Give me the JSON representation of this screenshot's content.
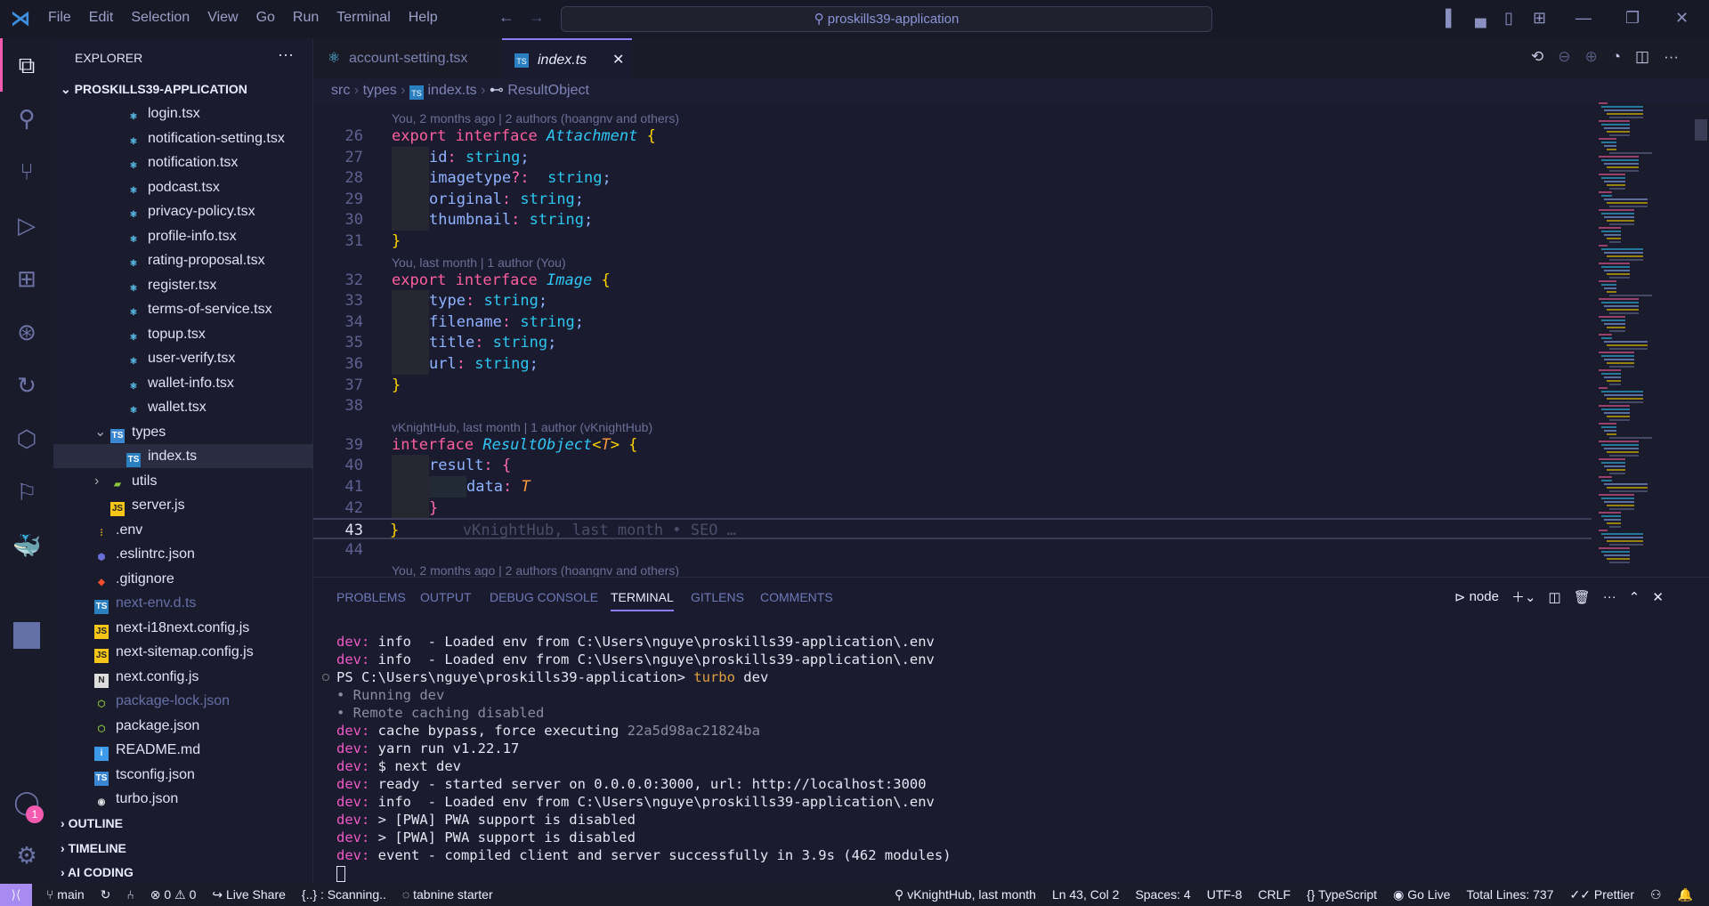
{
  "title_bar": {
    "menu": [
      "File",
      "Edit",
      "Selection",
      "View",
      "Go",
      "Run",
      "Terminal",
      "Help"
    ],
    "search": "proskills39-application"
  },
  "sidebar": {
    "header": "EXPLORER",
    "root": "PROSKILLS39-APPLICATION",
    "items": [
      {
        "label": "login.tsx",
        "icon": "react-icon",
        "indent": 2
      },
      {
        "label": "notification-setting.tsx",
        "icon": "react-icon",
        "indent": 2
      },
      {
        "label": "notification.tsx",
        "icon": "react-icon",
        "indent": 2
      },
      {
        "label": "podcast.tsx",
        "icon": "react-icon",
        "indent": 2
      },
      {
        "label": "privacy-policy.tsx",
        "icon": "react-icon",
        "indent": 2
      },
      {
        "label": "profile-info.tsx",
        "icon": "react-icon",
        "indent": 2
      },
      {
        "label": "rating-proposal.tsx",
        "icon": "react-icon",
        "indent": 2
      },
      {
        "label": "register.tsx",
        "icon": "react-icon",
        "indent": 2
      },
      {
        "label": "terms-of-service.tsx",
        "icon": "react-icon",
        "indent": 2
      },
      {
        "label": "topup.tsx",
        "icon": "react-icon",
        "indent": 2
      },
      {
        "label": "user-verify.tsx",
        "icon": "react-icon",
        "indent": 2
      },
      {
        "label": "wallet-info.tsx",
        "icon": "react-icon",
        "indent": 2
      },
      {
        "label": "wallet.tsx",
        "icon": "react-icon",
        "indent": 2
      },
      {
        "label": "types",
        "icon": "ts-folder-icon",
        "indent": 1,
        "chevron": "down"
      },
      {
        "label": "index.ts",
        "icon": "ts-file-icon",
        "indent": 2,
        "selected": true
      },
      {
        "label": "utils",
        "icon": "folder-icon",
        "indent": 1,
        "chevron": "right"
      },
      {
        "label": "server.js",
        "icon": "js-file-icon",
        "indent": 1
      },
      {
        "label": ".env",
        "icon": "env-icon",
        "indent": 0
      },
      {
        "label": ".eslintrc.json",
        "icon": "eslint-icon",
        "indent": 0
      },
      {
        "label": ".gitignore",
        "icon": "git-icon",
        "indent": 0
      },
      {
        "label": "next-env.d.ts",
        "icon": "ts-file-icon",
        "indent": 0,
        "dim": true
      },
      {
        "label": "next-i18next.config.js",
        "icon": "js-file-icon",
        "indent": 0
      },
      {
        "label": "next-sitemap.config.js",
        "icon": "js-file-icon",
        "indent": 0
      },
      {
        "label": "next.config.js",
        "icon": "next-icon",
        "indent": 0
      },
      {
        "label": "package-lock.json",
        "icon": "node-icon",
        "indent": 0,
        "dim": true
      },
      {
        "label": "package.json",
        "icon": "node-icon",
        "indent": 0
      },
      {
        "label": "README.md",
        "icon": "info-icon",
        "indent": 0
      },
      {
        "label": "tsconfig.json",
        "icon": "tsconfig-icon",
        "indent": 0
      },
      {
        "label": "turbo.json",
        "icon": "turbo-icon",
        "indent": 0
      }
    ],
    "sections": [
      "OUTLINE",
      "TIMELINE",
      "AI CODING"
    ],
    "account_badge": "1"
  },
  "tabs": [
    {
      "label": "account-setting.tsx",
      "active": false
    },
    {
      "label": "index.ts",
      "active": true
    }
  ],
  "breadcrumb": [
    "src",
    "types",
    "index.ts",
    "ResultObject"
  ],
  "editor": {
    "lines": [
      {
        "lens": "You, 2 months ago | 2 authors (hoangnv and others)"
      },
      {
        "n": "26",
        "tok": [
          [
            "export ",
            "kw"
          ],
          [
            "interface ",
            "kw"
          ],
          [
            "Attachment",
            "ty"
          ],
          [
            " {",
            "br"
          ]
        ]
      },
      {
        "n": "27",
        "ind": 1,
        "tok": [
          [
            "id",
            "pr"
          ],
          [
            ": ",
            "pc"
          ],
          [
            "string",
            "st"
          ],
          [
            ";",
            "pr"
          ]
        ]
      },
      {
        "n": "28",
        "ind": 1,
        "tok": [
          [
            "imagetype",
            "pr"
          ],
          [
            "?: ",
            "pc"
          ],
          [
            " string",
            "st"
          ],
          [
            ";",
            "pr"
          ]
        ]
      },
      {
        "n": "29",
        "ind": 1,
        "tok": [
          [
            "original",
            "pr"
          ],
          [
            ": ",
            "pc"
          ],
          [
            "string",
            "st"
          ],
          [
            ";",
            "pr"
          ]
        ]
      },
      {
        "n": "30",
        "ind": 1,
        "tok": [
          [
            "thumbnail",
            "pr"
          ],
          [
            ": ",
            "pc"
          ],
          [
            "string",
            "st"
          ],
          [
            ";",
            "pr"
          ]
        ]
      },
      {
        "n": "31",
        "tok": [
          [
            "}",
            "br"
          ]
        ]
      },
      {
        "lens": "You, last month | 1 author (You)"
      },
      {
        "n": "32",
        "tok": [
          [
            "export ",
            "kw"
          ],
          [
            "interface ",
            "kw"
          ],
          [
            "Image",
            "ty"
          ],
          [
            " {",
            "br"
          ]
        ]
      },
      {
        "n": "33",
        "ind": 1,
        "tok": [
          [
            "type",
            "pr"
          ],
          [
            ": ",
            "pc"
          ],
          [
            "string",
            "st"
          ],
          [
            ";",
            "pr"
          ]
        ]
      },
      {
        "n": "34",
        "ind": 1,
        "tok": [
          [
            "filename",
            "pr"
          ],
          [
            ": ",
            "pc"
          ],
          [
            "string",
            "st"
          ],
          [
            ";",
            "pr"
          ]
        ]
      },
      {
        "n": "35",
        "ind": 1,
        "tok": [
          [
            "title",
            "pr"
          ],
          [
            ": ",
            "pc"
          ],
          [
            "string",
            "st"
          ],
          [
            ";",
            "pr"
          ]
        ]
      },
      {
        "n": "36",
        "ind": 1,
        "tok": [
          [
            "url",
            "pr"
          ],
          [
            ": ",
            "pc"
          ],
          [
            "string",
            "st"
          ],
          [
            ";",
            "pr"
          ]
        ]
      },
      {
        "n": "37",
        "tok": [
          [
            "}",
            "br"
          ]
        ]
      },
      {
        "n": "38",
        "tok": []
      },
      {
        "lens": "vKnightHub, last month | 1 author (vKnightHub)"
      },
      {
        "n": "39",
        "tok": [
          [
            "interface ",
            "kw"
          ],
          [
            "ResultObject",
            "ty"
          ],
          [
            "<",
            "br"
          ],
          [
            "T",
            "ge"
          ],
          [
            ">",
            "br"
          ],
          [
            " {",
            "br"
          ]
        ]
      },
      {
        "n": "40",
        "ind": 1,
        "tok": [
          [
            "result",
            "pr"
          ],
          [
            ": ",
            "pc"
          ],
          [
            "{",
            "pc"
          ]
        ]
      },
      {
        "n": "41",
        "ind": 2,
        "tok": [
          [
            "data",
            "pr"
          ],
          [
            ": ",
            "pc"
          ],
          [
            "T",
            "ge"
          ]
        ]
      },
      {
        "n": "42",
        "ind": 1,
        "tok": [
          [
            "}",
            "pc"
          ]
        ]
      },
      {
        "n": "43",
        "current": true,
        "tok": [
          [
            "}",
            "br"
          ],
          [
            "       vKnightHub, last month • SEO …",
            "gh"
          ]
        ]
      },
      {
        "n": "44",
        "tok": []
      },
      {
        "lens": "You, 2 months ago | 2 authors (hoangnv and others)"
      }
    ]
  },
  "panel": {
    "tabs": [
      "PROBLEMS",
      "OUTPUT",
      "DEBUG CONSOLE",
      "TERMINAL",
      "GITLENS",
      "COMMENTS"
    ],
    "active": "TERMINAL",
    "shell": "node",
    "terminal": [
      [
        [
          "dev:",
          "dv"
        ],
        [
          " info  - Loaded env from C:\\Users\\nguye\\proskills39-application\\.env",
          ""
        ]
      ],
      [
        [
          "dev:",
          "dv"
        ],
        [
          " info  - Loaded env from C:\\Users\\nguye\\proskills39-application\\.env",
          ""
        ]
      ],
      [
        [
          "PS C:\\Users\\nguye\\proskills39-application> ",
          ""
        ],
        [
          "turbo",
          "yl"
        ],
        [
          " dev",
          ""
        ]
      ],
      [
        [
          "• Running ",
          "dim"
        ],
        [
          "dev",
          "dim"
        ]
      ],
      [
        [
          "• Remote caching disabled",
          "dim"
        ]
      ],
      [
        [
          "dev:",
          "dv"
        ],
        [
          " cache bypass, force executing ",
          ""
        ],
        [
          "22a5d98ac21824ba",
          "dim"
        ]
      ],
      [
        [
          "dev:",
          "dv"
        ],
        [
          " yarn run v1.22.17",
          ""
        ]
      ],
      [
        [
          "dev:",
          "dv"
        ],
        [
          " $ next dev",
          ""
        ]
      ],
      [
        [
          "dev:",
          "dv"
        ],
        [
          " ready - started server on 0.0.0.0:3000, url: http://localhost:3000",
          ""
        ]
      ],
      [
        [
          "dev:",
          "dv"
        ],
        [
          " info  - Loaded env from C:\\Users\\nguye\\proskills39-application\\.env",
          ""
        ]
      ],
      [
        [
          "dev:",
          "dv"
        ],
        [
          " > [PWA] PWA support is disabled",
          ""
        ]
      ],
      [
        [
          "dev:",
          "dv"
        ],
        [
          " > [PWA] PWA support is disabled",
          ""
        ]
      ],
      [
        [
          "dev:",
          "dv"
        ],
        [
          " event - compiled client and server successfully in 3.9s (462 modules)",
          ""
        ]
      ]
    ]
  },
  "status": {
    "branch": "main",
    "errors": "0",
    "warnings": "0",
    "live_share": "Live Share",
    "scanning": "{..} : Scanning..",
    "tabnine": "tabnine starter",
    "blame": "vKnightHub, last month",
    "position": "Ln 43, Col 2",
    "spaces": "Spaces: 4",
    "encoding": "UTF-8",
    "eol": "CRLF",
    "language": "TypeScript",
    "go_live": "Go Live",
    "total_lines": "Total Lines: 737",
    "prettier": "Prettier"
  },
  "colors": {
    "accent": "#8b7cf6",
    "remote": "#a88bf0",
    "keyword": "#ff5f9e",
    "type": "#2fc6f5",
    "brace": "#ffd500",
    "badge": "#f45bb0"
  }
}
